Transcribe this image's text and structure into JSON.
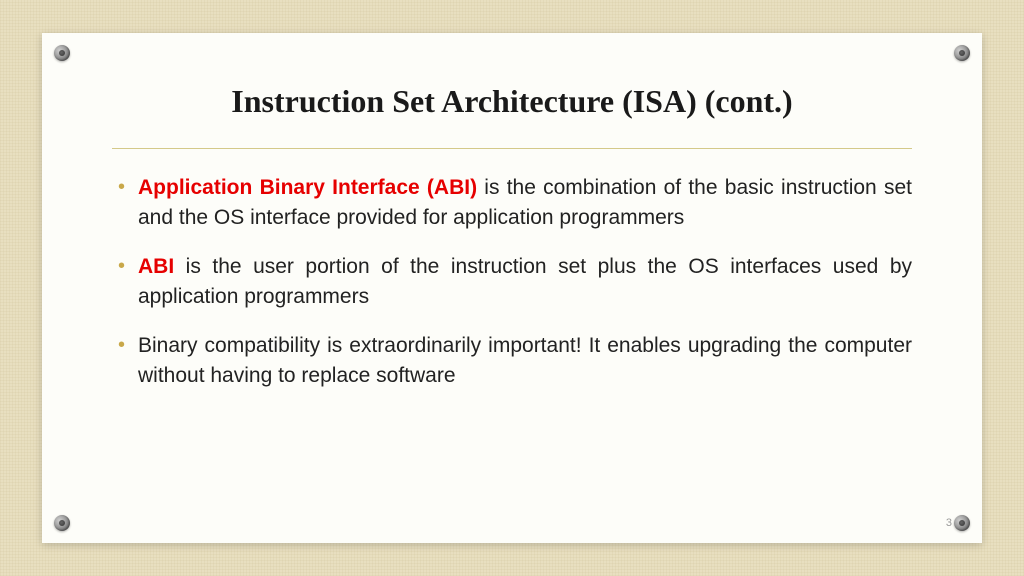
{
  "slide": {
    "title": "Instruction Set Architecture (ISA) (cont.)",
    "bullets": [
      {
        "highlight": "Application Binary Interface (ABI)",
        "rest": " is the combination of the basic instruction set and the OS interface provided for application programmers"
      },
      {
        "highlight": "ABI",
        "rest": " is the user portion of the instruction set plus the OS interfaces used by application programmers"
      },
      {
        "highlight": "",
        "rest": "Binary compatibility is extraordinarily important! It enables upgrading the computer without having to replace software"
      }
    ],
    "pageNumber": "3"
  }
}
